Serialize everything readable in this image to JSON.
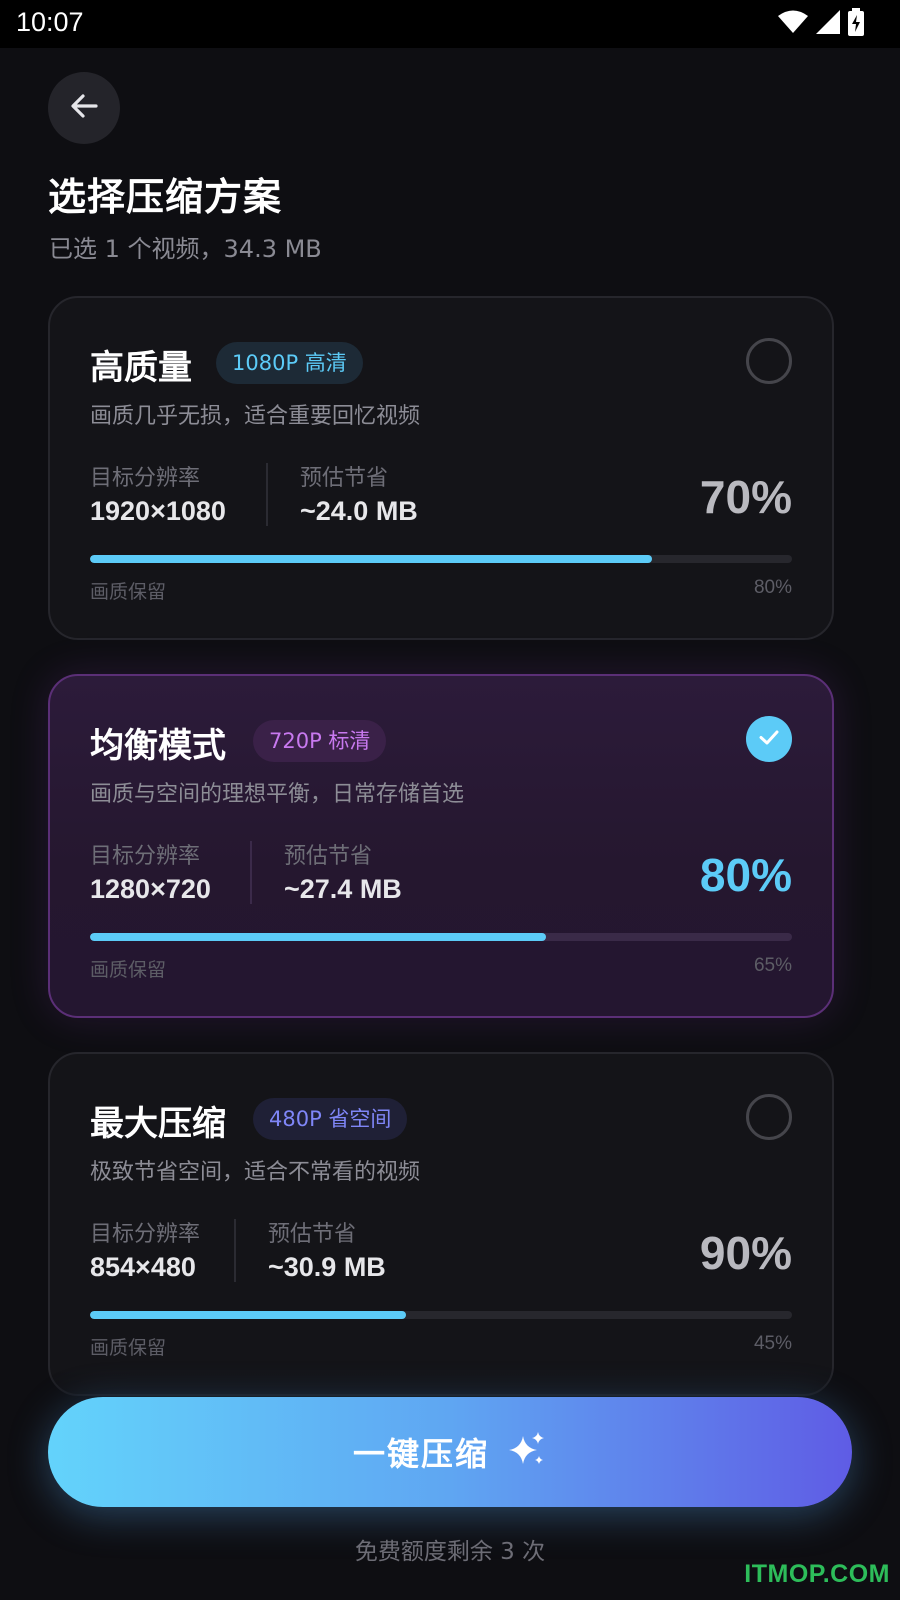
{
  "status_bar": {
    "time": "10:07",
    "icons": [
      "wifi-icon",
      "signal-icon",
      "battery-charging-icon"
    ]
  },
  "header": {
    "back_icon": "arrow-left-icon",
    "title": "选择压缩方案",
    "subtitle": "已选 1 个视频，34.3 MB"
  },
  "plans": [
    {
      "title": "高质量",
      "tag": "1080P 高清",
      "tag_color": "#5ccbf7",
      "tag_bg": "#1d2a36",
      "description": "画质几乎无损，适合重要回忆视频",
      "resolution_label": "目标分辨率",
      "resolution": "1920×1080",
      "savings_label": "预估节省",
      "savings": "~24.0 MB",
      "percent": "70%",
      "quality_label": "画质保留",
      "quality_pct": "80%",
      "quality_value": 0.8,
      "selected": false
    },
    {
      "title": "均衡模式",
      "tag": "720P 标清",
      "tag_color": "#c879ef",
      "tag_bg": "#3a2148",
      "description": "画质与空间的理想平衡，日常存储首选",
      "resolution_label": "目标分辨率",
      "resolution": "1280×720",
      "savings_label": "预估节省",
      "savings": "~27.4 MB",
      "percent": "80%",
      "quality_label": "画质保留",
      "quality_pct": "65%",
      "quality_value": 0.65,
      "selected": true
    },
    {
      "title": "最大压缩",
      "tag": "480P 省空间",
      "tag_color": "#7f86f7",
      "tag_bg": "#1f2036",
      "description": "极致节省空间，适合不常看的视频",
      "resolution_label": "目标分辨率",
      "resolution": "854×480",
      "savings_label": "预估节省",
      "savings": "~30.9 MB",
      "percent": "90%",
      "quality_label": "画质保留",
      "quality_pct": "45%",
      "quality_value": 0.45,
      "selected": false
    }
  ],
  "cta": {
    "label": "一键压缩",
    "icon": "sparkles-icon"
  },
  "quota": "免费额度剩余 3 次",
  "watermark": "ITMOP.COM",
  "colors": {
    "accent": "#5ccbf7",
    "cta_gradient_start": "#63d3fb",
    "cta_gradient_end": "#5f5ce5",
    "selected_border": "#5b2f77",
    "background": "#0e0e12"
  }
}
